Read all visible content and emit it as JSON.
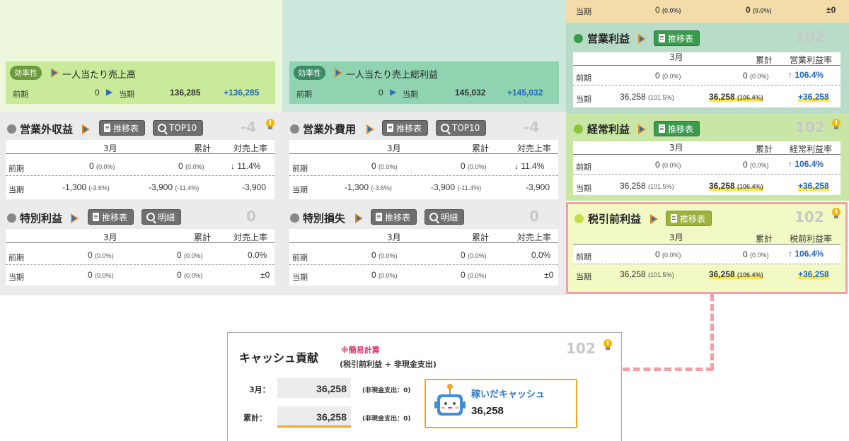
{
  "common": {
    "month": "3月",
    "cumulative": "累計",
    "prev": "前期",
    "curr": "当期",
    "ratio": "対売上率",
    "detail_btn": "推移表",
    "top10_btn": "TOP10",
    "meisai_btn": "明細"
  },
  "top_row": {
    "prev_label": "当期",
    "v1": "0",
    "p1": "(0.0%)",
    "v2": "0",
    "p2": "(0.0%)",
    "diff": "±0"
  },
  "kpi1": {
    "badge": "効率性",
    "title": "一人当たり売上高",
    "prev_label": "前期",
    "prev_value": "0",
    "curr_label": "当期",
    "curr_value": "136,285",
    "diff": "+136,285"
  },
  "kpi2": {
    "badge": "効率性",
    "title": "一人当たり売上総利益",
    "prev_label": "前期",
    "prev_value": "0",
    "curr_label": "当期",
    "curr_value": "145,032",
    "diff": "+145,032"
  },
  "p_eigyo_gai_shueki": {
    "title": "営業外収益",
    "score": "-4",
    "prev": {
      "m": "0",
      "mp": "(0.0%)",
      "c": "0",
      "cp": "(0.0%)",
      "r": "11.4%"
    },
    "curr": {
      "m": "-1,300",
      "mp": "(-3.6%)",
      "c": "-3,900",
      "cp": "(-11.4%)",
      "r": "-3,900"
    }
  },
  "p_eigyo_gai_hiyo": {
    "title": "営業外費用",
    "score": "-4",
    "prev": {
      "m": "0",
      "mp": "(0.0%)",
      "c": "0",
      "cp": "(0.0%)",
      "r": "11.4%"
    },
    "curr": {
      "m": "-1,300",
      "mp": "(-3.6%)",
      "c": "-3,900",
      "cp": "(-11.4%)",
      "r": "-3,900"
    }
  },
  "p_tokubetsu_rieki": {
    "title": "特別利益",
    "score": "0",
    "prev": {
      "m": "0",
      "mp": "(0.0%)",
      "c": "0",
      "cp": "(0.0%)",
      "r": "0.0%"
    },
    "curr": {
      "m": "0",
      "mp": "(0.0%)",
      "c": "0",
      "cp": "(0.0%)",
      "r": "±0"
    }
  },
  "p_tokubetsu_sonshitsu": {
    "title": "特別損失",
    "score": "0",
    "prev": {
      "m": "0",
      "mp": "(0.0%)",
      "c": "0",
      "cp": "(0.0%)",
      "r": "0.0%"
    },
    "curr": {
      "m": "0",
      "mp": "(0.0%)",
      "c": "0",
      "cp": "(0.0%)",
      "r": "±0"
    }
  },
  "p_eigyo_rieki": {
    "title": "営業利益",
    "score": "102",
    "ratio": "営業利益率",
    "prev": {
      "m": "0",
      "mp": "(0.0%)",
      "c": "0",
      "cp": "(0.0%)",
      "r": "106.4%"
    },
    "curr": {
      "m": "36,258",
      "mp": "(101.5%)",
      "c": "36,258",
      "cp": "(106.4%)",
      "r": "+36,258"
    }
  },
  "p_keijo_rieki": {
    "title": "経常利益",
    "score": "102",
    "ratio": "経常利益率",
    "prev": {
      "m": "0",
      "mp": "(0.0%)",
      "c": "0",
      "cp": "(0.0%)",
      "r": "106.4%"
    },
    "curr": {
      "m": "36,258",
      "mp": "(101.5%)",
      "c": "36,258",
      "cp": "(106.4%)",
      "r": "+36,258"
    }
  },
  "p_zeibiki_mae": {
    "title": "税引前利益",
    "score": "102",
    "ratio": "税前利益率",
    "prev": {
      "m": "0",
      "mp": "(0.0%)",
      "c": "0",
      "cp": "(0.0%)",
      "r": "106.4%"
    },
    "curr": {
      "m": "36,258",
      "mp": "(101.5%)",
      "c": "36,258",
      "cp": "(106.4%)",
      "r": "+36,258"
    }
  },
  "cash": {
    "title": "キャッシュ貢献",
    "note": "※簡易計算",
    "formula": "(税引前利益 + 非現金支出)",
    "score": "102",
    "month_label": "3月：",
    "month_value": "36,258",
    "month_note": "(非現金支出：0)",
    "cum_label": "累計：",
    "cum_value": "36,258",
    "cum_note": "(非現金支出：0)",
    "earned_label": "稼いだキャッシュ",
    "earned_value": "36,258"
  },
  "colors": {
    "light_green": "#ecf7dc",
    "kpi1": "#c8ea9a",
    "teal_bg": "#cce8dc",
    "kpi2": "#8fd3b0",
    "gray_bg": "#ebebeb",
    "orange_bg": "#f3dca7",
    "green_panel": "#b9dcc8",
    "lgreen_panel": "#c9e6a6",
    "yellow_panel": "#f2f9c4",
    "pink_border": "#f0a0a8"
  }
}
